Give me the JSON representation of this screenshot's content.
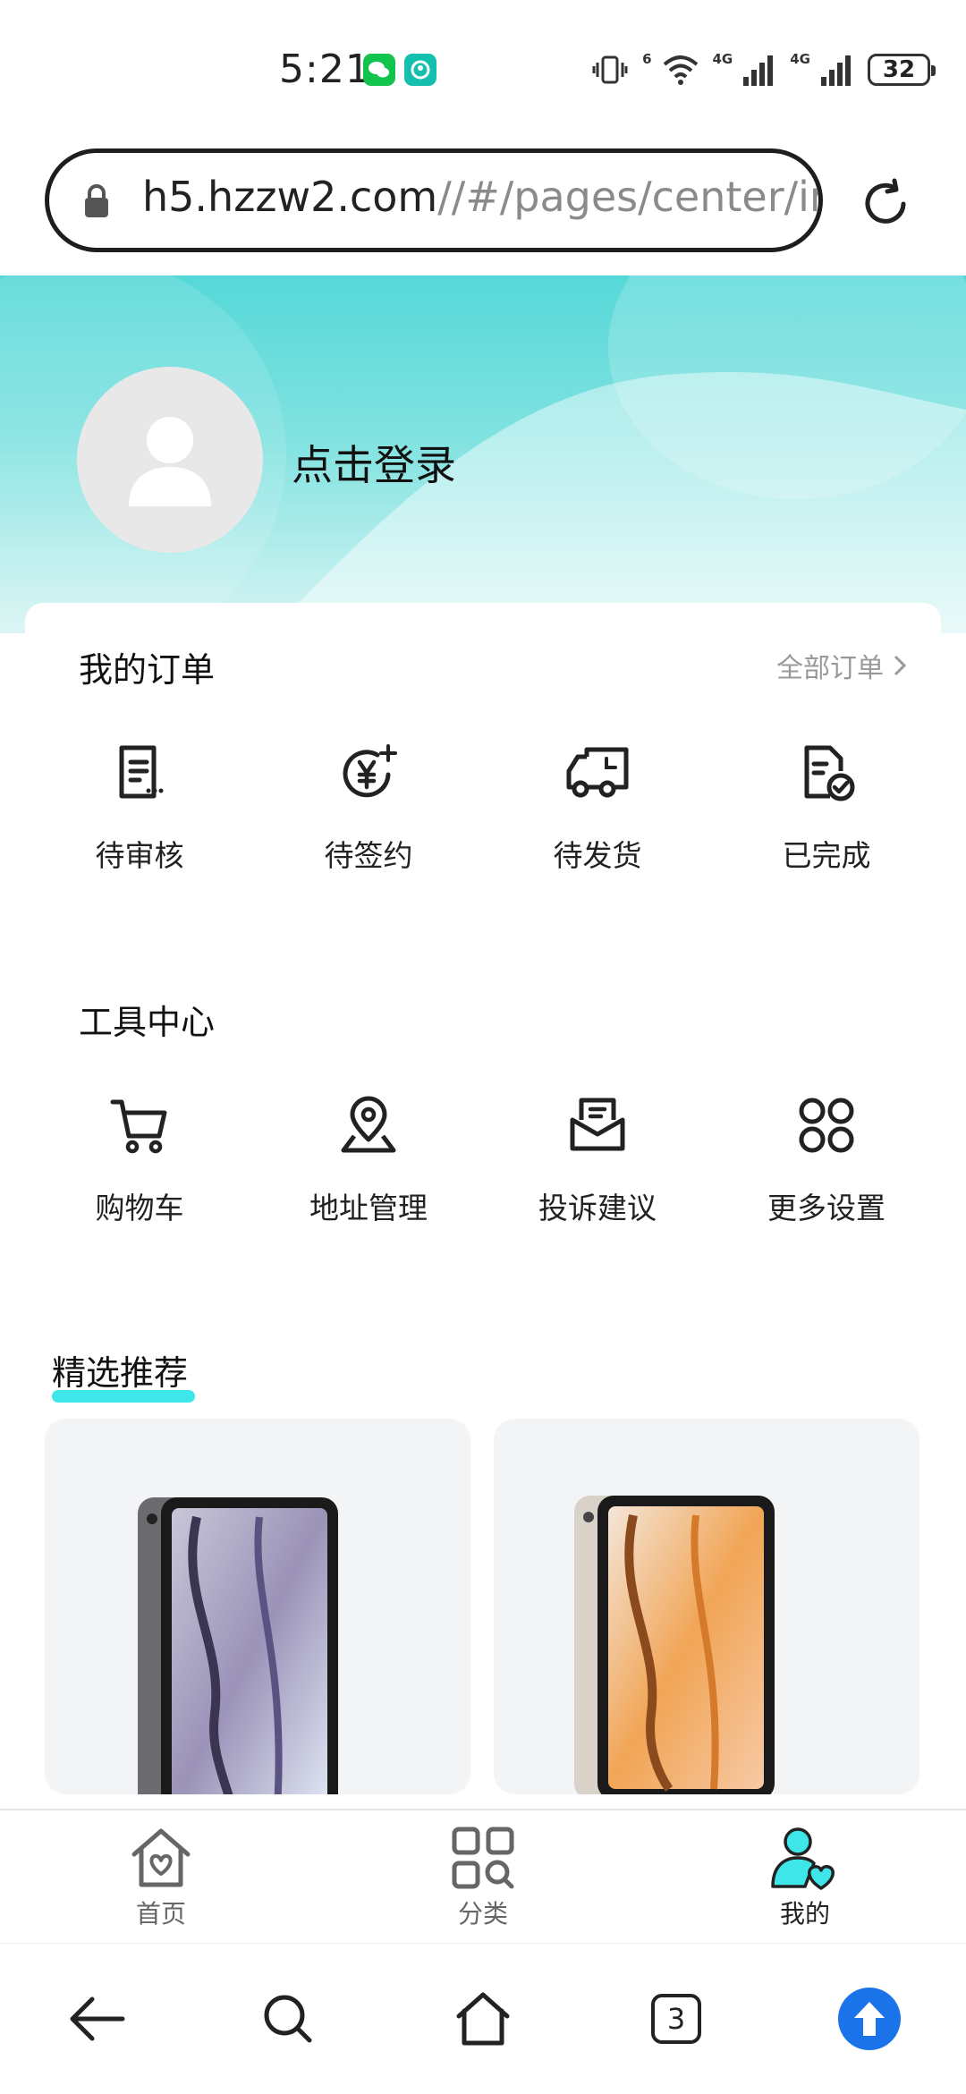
{
  "status": {
    "time": "5:21",
    "battery": "32",
    "net1": "4G",
    "net2": "4G",
    "wifi_tag": "6"
  },
  "browser": {
    "url_host": "h5.hzzw2.com",
    "url_path": "//#/pages/center/inc",
    "tabs_count": "3"
  },
  "header": {
    "login_label": "点击登录"
  },
  "orders": {
    "title": "我的订单",
    "all_label": "全部订单",
    "items": [
      {
        "label": "待审核",
        "icon": "document-list-icon"
      },
      {
        "label": "待签约",
        "icon": "yen-coin-icon"
      },
      {
        "label": "待发货",
        "icon": "delivery-truck-icon"
      },
      {
        "label": "已完成",
        "icon": "document-check-icon"
      }
    ]
  },
  "tools": {
    "title": "工具中心",
    "items": [
      {
        "label": "购物车",
        "icon": "cart-icon"
      },
      {
        "label": "地址管理",
        "icon": "location-pin-icon"
      },
      {
        "label": "投诉建议",
        "icon": "message-envelope-icon"
      },
      {
        "label": "更多设置",
        "icon": "grid-clover-icon"
      }
    ]
  },
  "recommend": {
    "title": "精选推荐",
    "products": [
      {
        "color": "#7a7a80"
      },
      {
        "color": "#e79a3e"
      }
    ]
  },
  "tabbar": {
    "items": [
      {
        "label": "首页",
        "icon": "home-heart-icon"
      },
      {
        "label": "分类",
        "icon": "category-search-icon"
      },
      {
        "label": "我的",
        "icon": "user-heart-icon",
        "active": true
      }
    ]
  },
  "colors": {
    "accent": "#3ee6ea",
    "header_top": "#56d8d8",
    "link_grey": "#999999",
    "nav_blue": "#1a73e8"
  }
}
